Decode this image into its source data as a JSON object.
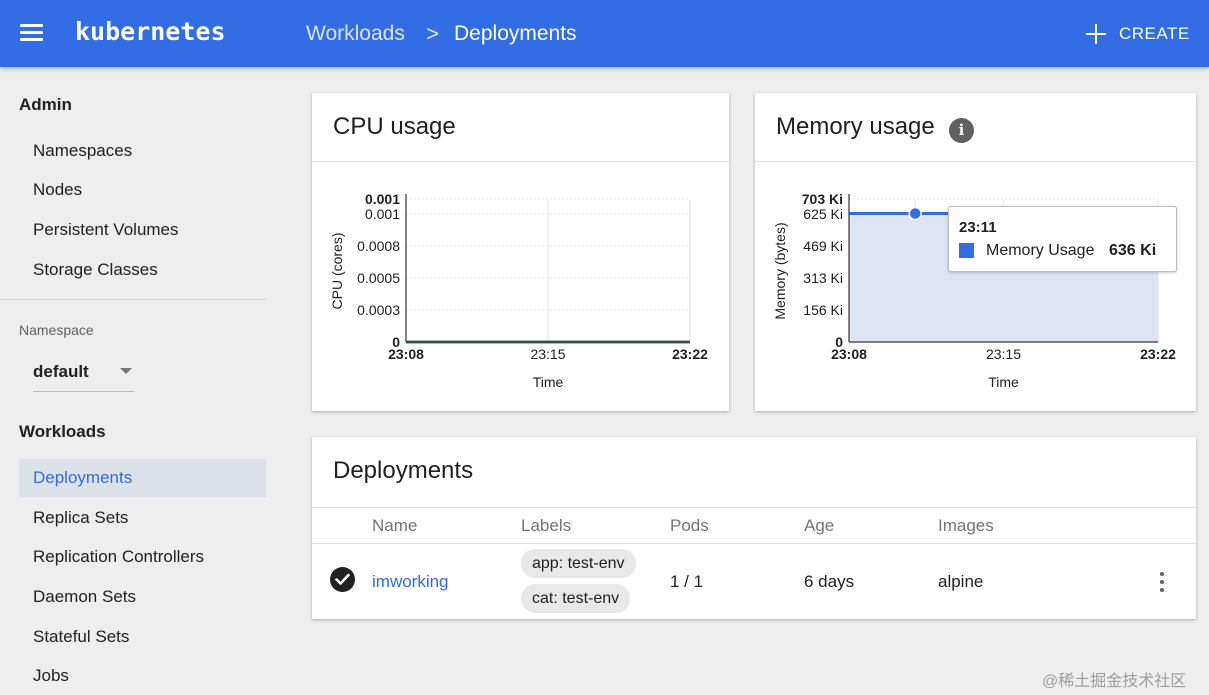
{
  "header": {
    "brand": "kubernetes",
    "breadcrumb_parent": "Workloads",
    "breadcrumb_separator": ">",
    "breadcrumb_current": "Deployments",
    "create_label": "CREATE"
  },
  "sidebar": {
    "admin_title": "Admin",
    "admin_items": [
      {
        "label": "Namespaces"
      },
      {
        "label": "Nodes"
      },
      {
        "label": "Persistent Volumes"
      },
      {
        "label": "Storage Classes"
      }
    ],
    "namespace_label": "Namespace",
    "namespace_value": "default",
    "workloads_title": "Workloads",
    "workload_items": [
      {
        "label": "Deployments",
        "active": true
      },
      {
        "label": "Replica Sets"
      },
      {
        "label": "Replication Controllers"
      },
      {
        "label": "Daemon Sets"
      },
      {
        "label": "Stateful Sets"
      },
      {
        "label": "Jobs"
      }
    ]
  },
  "cpu_card": {
    "title": "CPU usage"
  },
  "memory_card": {
    "title": "Memory usage",
    "info_icon": "info-icon",
    "tooltip": {
      "time": "23:11",
      "series": "Memory Usage",
      "value": "636 Ki"
    }
  },
  "chart_data": [
    {
      "type": "line",
      "title": "CPU usage",
      "xlabel": "Time",
      "ylabel": "CPU (cores)",
      "x_ticks": [
        "23:08",
        "23:15",
        "23:22"
      ],
      "y_ticks": [
        "0",
        "0.0003",
        "0.0005",
        "0.0008",
        "0.001",
        "0.001"
      ],
      "ylim": [
        0,
        0.00105
      ],
      "grid": true,
      "series": [
        {
          "name": "",
          "color": "#4a7a6f",
          "x": [
            "23:08",
            "23:22"
          ],
          "values": [
            0,
            0
          ]
        }
      ]
    },
    {
      "type": "area",
      "title": "Memory usage",
      "xlabel": "Time",
      "ylabel": "Memory (bytes)",
      "x_ticks": [
        "23:08",
        "23:15",
        "23:22"
      ],
      "y_ticks": [
        "0",
        "156 Ki",
        "313 Ki",
        "469 Ki",
        "625 Ki",
        "703 Ki"
      ],
      "ylim": [
        0,
        703
      ],
      "grid": true,
      "highlight_x": "23:11",
      "series": [
        {
          "name": "Memory Usage",
          "color": "#326de6",
          "x": [
            "23:08",
            "23:22"
          ],
          "values": [
            636,
            636
          ]
        }
      ]
    }
  ],
  "deployments": {
    "title": "Deployments",
    "columns": [
      "Name",
      "Labels",
      "Pods",
      "Age",
      "Images"
    ],
    "rows": [
      {
        "status": "check-circle-icon",
        "name": "imworking",
        "labels": [
          "app: test-env",
          "cat: test-env"
        ],
        "pods": "1 / 1",
        "age": "6 days",
        "images": "alpine"
      }
    ]
  },
  "watermark": "@稀土掘金技术社区",
  "colors": {
    "primary": "#326de6",
    "background": "#eeeeee",
    "active_nav": "#dde1e8",
    "cpu_line": "#4a7a6f"
  }
}
